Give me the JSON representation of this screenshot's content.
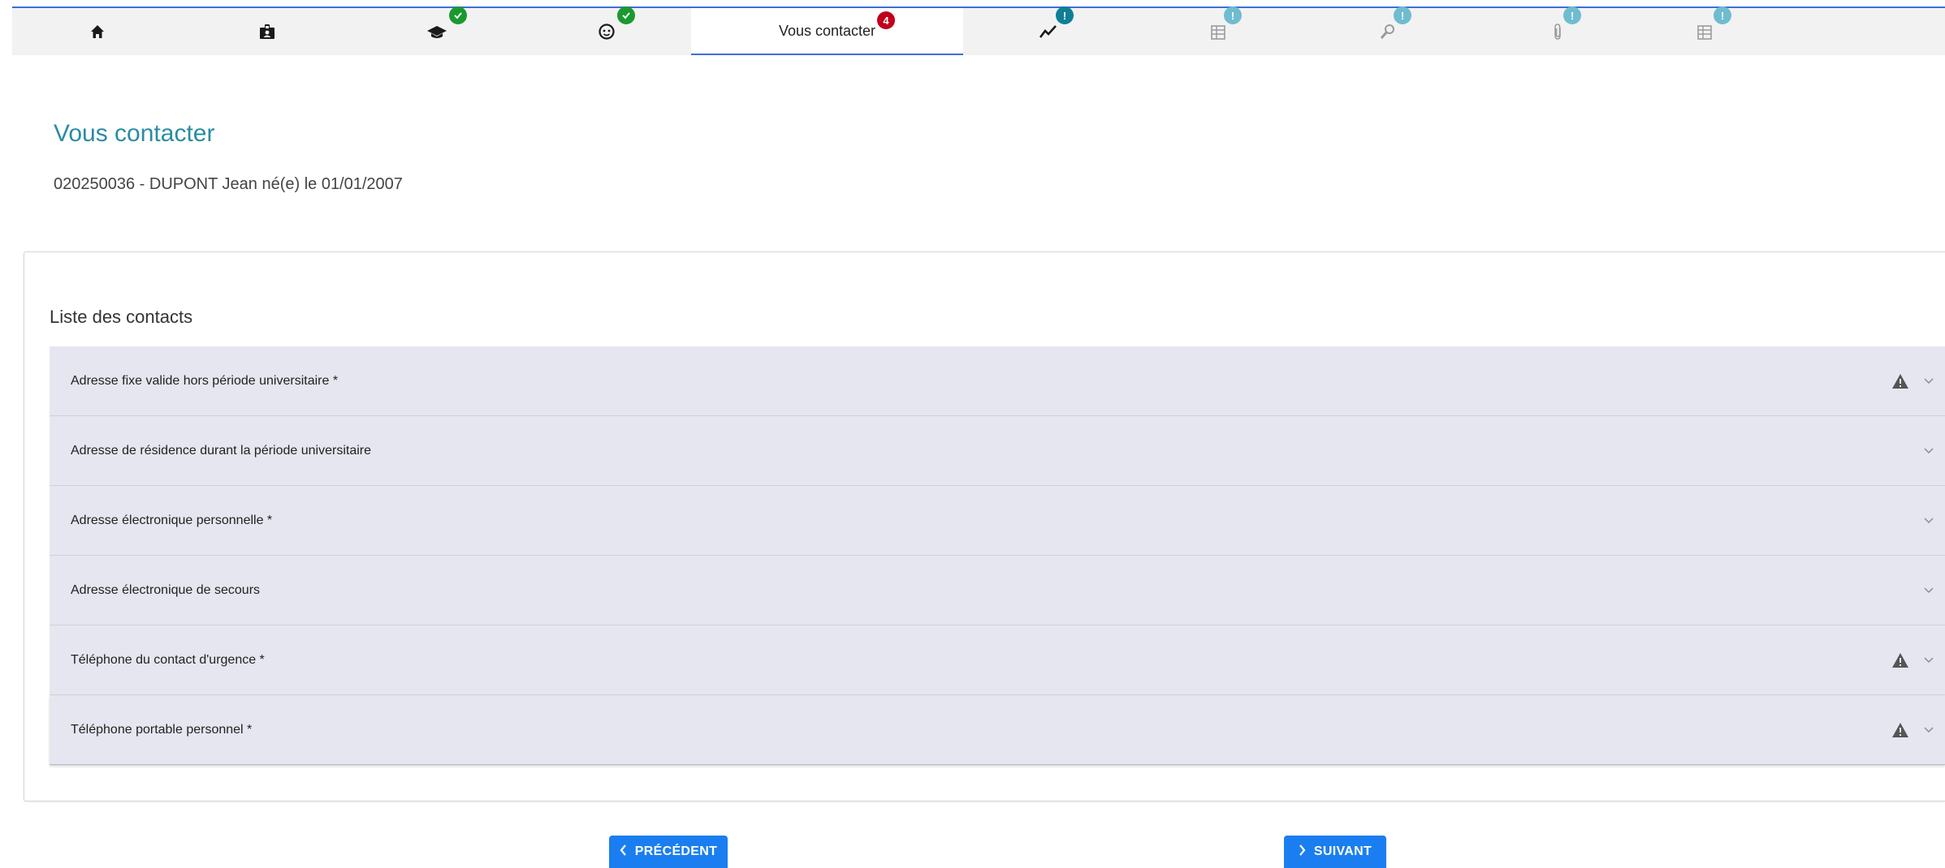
{
  "tabs": [
    {
      "name": "home",
      "icon": "home-icon",
      "badge": null
    },
    {
      "name": "id-card",
      "icon": "id-badge-icon",
      "badge": null
    },
    {
      "name": "education",
      "icon": "graduation-cap-icon",
      "badge": "check"
    },
    {
      "name": "face",
      "icon": "face-icon",
      "badge": "check"
    },
    {
      "name": "contact",
      "label": "Vous contacter",
      "badge": "4",
      "active": true
    },
    {
      "name": "chart",
      "icon": "line-chart-icon",
      "badge": "!"
    },
    {
      "name": "table",
      "icon": "table-icon",
      "badge": "!"
    },
    {
      "name": "search",
      "icon": "magnifier-icon",
      "badge": "!"
    },
    {
      "name": "attachment",
      "icon": "paperclip-icon",
      "badge": "!"
    },
    {
      "name": "summary",
      "icon": "table-icon",
      "badge": "!"
    }
  ],
  "tab_contact_label": "Vous contacter",
  "tab_contact_badge": "4",
  "badge_exclamation": "!",
  "colors": {
    "accent": "#2a8ca3",
    "badge_check": "#1a9a2e",
    "badge_error": "#c0001a",
    "badge_info_dark": "#0e7f96",
    "badge_info_light": "#6fbcd0",
    "button": "#1a7ef0",
    "row_bg": "#e6e6f0"
  },
  "header": {
    "title": "Vous contacter",
    "student": "020250036 - DUPONT Jean né(e) le 01/01/2007"
  },
  "contacts": {
    "title": "Liste des contacts",
    "items": [
      {
        "label": "Adresse fixe valide hors période universitaire *",
        "warning": true
      },
      {
        "label": "Adresse de résidence durant la période universitaire",
        "warning": false
      },
      {
        "label": "Adresse électronique personnelle *",
        "warning": false
      },
      {
        "label": "Adresse électronique de secours",
        "warning": false
      },
      {
        "label": "Téléphone du contact d'urgence *",
        "warning": true
      },
      {
        "label": "Téléphone portable personnel *",
        "warning": true
      }
    ]
  },
  "nav": {
    "prev_label": "PRÉCÉDENT",
    "next_label": "SUIVANT"
  }
}
